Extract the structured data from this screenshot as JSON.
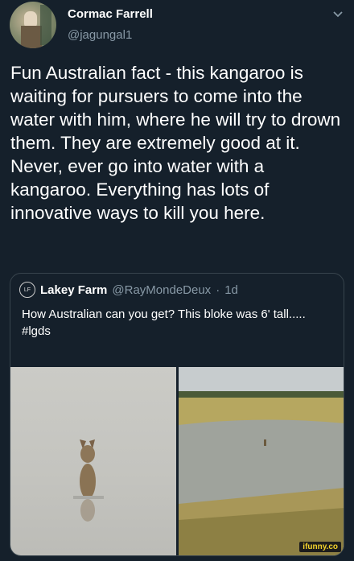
{
  "tweet": {
    "author_name": "Cormac Farrell",
    "author_handle": "@jagungal1",
    "text": "Fun Australian fact - this kangaroo is waiting for pursuers to come into the water with him, where he will try to drown them.  They are extremely good at it.\nNever, ever go into water with a kangaroo.  Everything has lots of innovative ways to kill you here."
  },
  "quoted_tweet": {
    "author_name": "Lakey Farm",
    "author_handle": "@RayMondeDeux",
    "separator": "·",
    "time": "1d",
    "text": "How Australian can you get? This bloke was 6' tall.....\n#lgds"
  },
  "watermark": "ifunny.co",
  "icons": {
    "caret": "chevron-down-icon",
    "logo": "lakey-farm-logo-icon"
  },
  "colors": {
    "background": "#15202b",
    "secondary_text": "#8899a6",
    "border": "#38444d"
  }
}
